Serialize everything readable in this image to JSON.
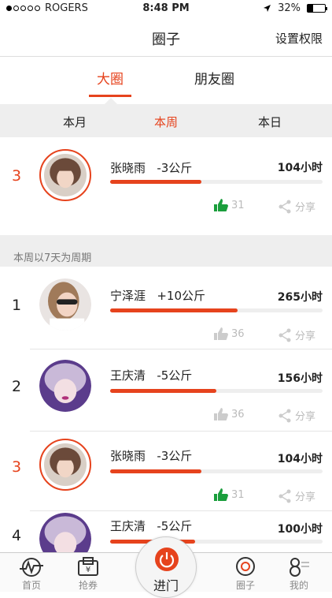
{
  "status": {
    "carrier": "ROGERS",
    "time": "8:48 PM",
    "battery": "32%"
  },
  "header": {
    "title": "圈子",
    "right_action": "设置权限"
  },
  "circle_tabs": [
    {
      "label": "大圈",
      "active": true
    },
    {
      "label": "朋友圈",
      "active": false
    }
  ],
  "period_tabs": [
    {
      "label": "本月",
      "active": false
    },
    {
      "label": "本周",
      "active": true
    },
    {
      "label": "本日",
      "active": false
    }
  ],
  "my_entry": {
    "rank": "3",
    "name": "张晓雨",
    "weight": "-3公斤",
    "hours": "104小时",
    "progress": 0.43,
    "likes": "31",
    "liked": true,
    "share": "分享"
  },
  "period_note": "本周以7天为周期",
  "ranking": [
    {
      "rank": "1",
      "name": "宁泽涯",
      "weight": "+10公斤",
      "hours": "265小时",
      "progress": 0.6,
      "likes": "36",
      "liked": false,
      "share": "分享"
    },
    {
      "rank": "2",
      "name": "王庆清",
      "weight": "-5公斤",
      "hours": "156小时",
      "progress": 0.5,
      "likes": "36",
      "liked": false,
      "share": "分享"
    },
    {
      "rank": "3",
      "name": "张晓雨",
      "weight": "-3公斤",
      "hours": "104小时",
      "progress": 0.43,
      "likes": "31",
      "liked": true,
      "share": "分享"
    },
    {
      "rank": "4",
      "name": "王庆清",
      "weight": "-5公斤",
      "hours": "100小时",
      "progress": 0.4
    }
  ],
  "tabbar": {
    "home": "首页",
    "coupon": "抢券",
    "go": "进门",
    "circle": "圈子",
    "mine": "我的"
  },
  "colors": {
    "accent": "#e6431d",
    "like": "#1a9e3c"
  }
}
